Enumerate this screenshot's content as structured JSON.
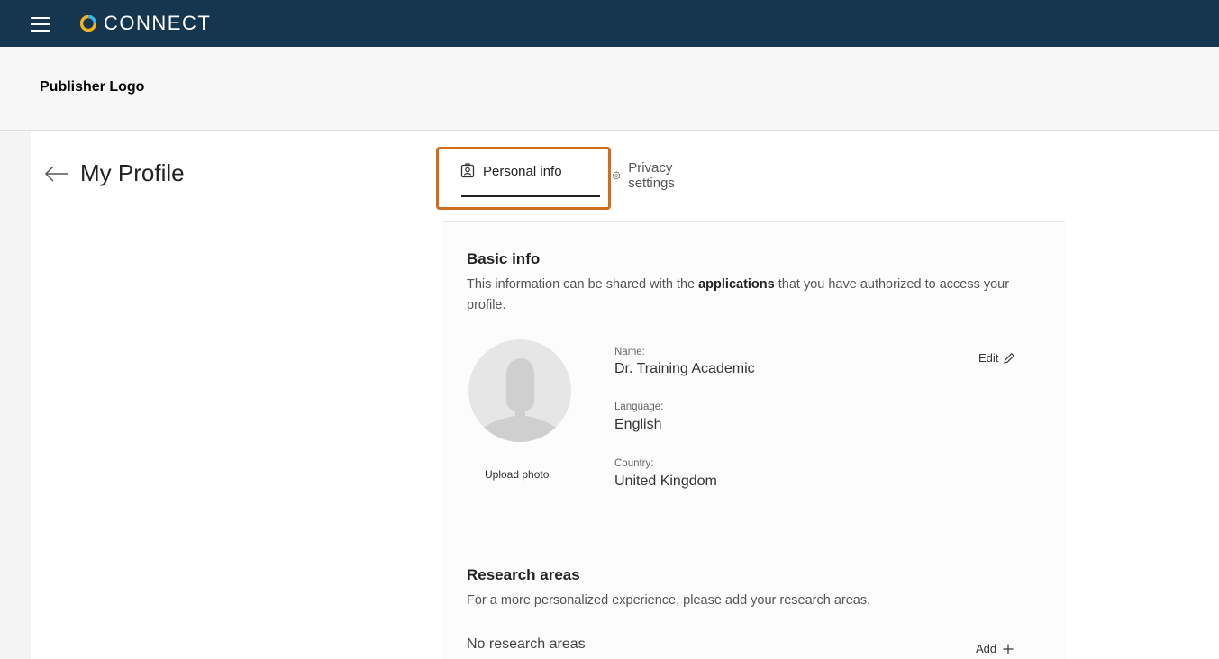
{
  "header": {
    "brand": "CONNECT",
    "menu_icon": "hamburger-menu-icon",
    "logo_icon": "connect-logo-icon",
    "bg_color": "#163650"
  },
  "publisher": {
    "logo_text": "Publisher Logo"
  },
  "page": {
    "title": "My Profile",
    "back_icon": "arrow-left-icon"
  },
  "tabs": [
    {
      "label": "Personal info",
      "icon": "id-badge-icon",
      "active": true
    },
    {
      "label": "Privacy settings",
      "icon": "gear-icon",
      "active": false
    }
  ],
  "highlight_color": "#d06c1a",
  "basic_info": {
    "title": "Basic info",
    "desc_before": "This information can be shared with the ",
    "desc_bold": "applications",
    "desc_after": " that you have authorized to access your profile.",
    "upload_label": "Upload photo",
    "edit_label": "Edit",
    "fields": [
      {
        "label": "Name:",
        "value": "Dr. Training Academic"
      },
      {
        "label": "Language:",
        "value": "English"
      },
      {
        "label": "Country:",
        "value": "United Kingdom"
      }
    ]
  },
  "research_areas": {
    "title": "Research areas",
    "desc": "For a more personalized experience, please add your research areas.",
    "empty_text": "No research areas",
    "add_label": "Add"
  }
}
